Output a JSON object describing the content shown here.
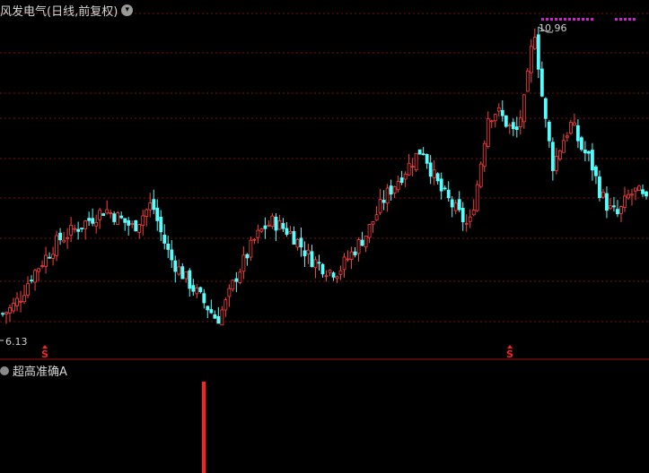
{
  "header": {
    "title": "风发电气(日线,前复权)",
    "dropdown_icon": "chevron-down-icon"
  },
  "price_chart": {
    "high_label": "10.96",
    "low_label": "6.13",
    "signal_marker": "S",
    "colors": {
      "up": "#ff4040",
      "down": "#54ffff",
      "grid": "#7a1010",
      "axis": "#a01010",
      "marker": "#ff2020",
      "top_dots": "#d020d0"
    }
  },
  "indicator": {
    "title": "超高准确A",
    "icon": "circle-icon",
    "bar_color": "#ff2020"
  },
  "chart_data": {
    "type": "candlestick",
    "ylim": [
      6.13,
      10.96
    ],
    "high": 10.96,
    "low": 6.13,
    "close_series": [
      6.3,
      6.4,
      6.6,
      6.9,
      7.1,
      7.3,
      7.5,
      7.6,
      7.7,
      7.8,
      7.9,
      8.0,
      7.9,
      7.8,
      7.7,
      7.9,
      8.1,
      7.6,
      7.2,
      7.0,
      6.8,
      6.6,
      6.4,
      6.2,
      6.5,
      6.9,
      7.2,
      7.5,
      7.7,
      7.8,
      7.7,
      7.6,
      7.4,
      7.2,
      7.1,
      7.0,
      7.0,
      7.2,
      7.4,
      7.6,
      7.9,
      8.2,
      8.4,
      8.6,
      8.8,
      9.0,
      8.6,
      8.3,
      8.1,
      7.9,
      7.7,
      8.5,
      9.5,
      9.6,
      9.4,
      9.2,
      9.8,
      10.96,
      9.6,
      8.7,
      9.1,
      9.4,
      9.0,
      8.8,
      8.3,
      8.0,
      7.9,
      8.2,
      8.3,
      8.1
    ],
    "signal_markers": [
      "S",
      "S"
    ],
    "indicator_bars": 1
  }
}
